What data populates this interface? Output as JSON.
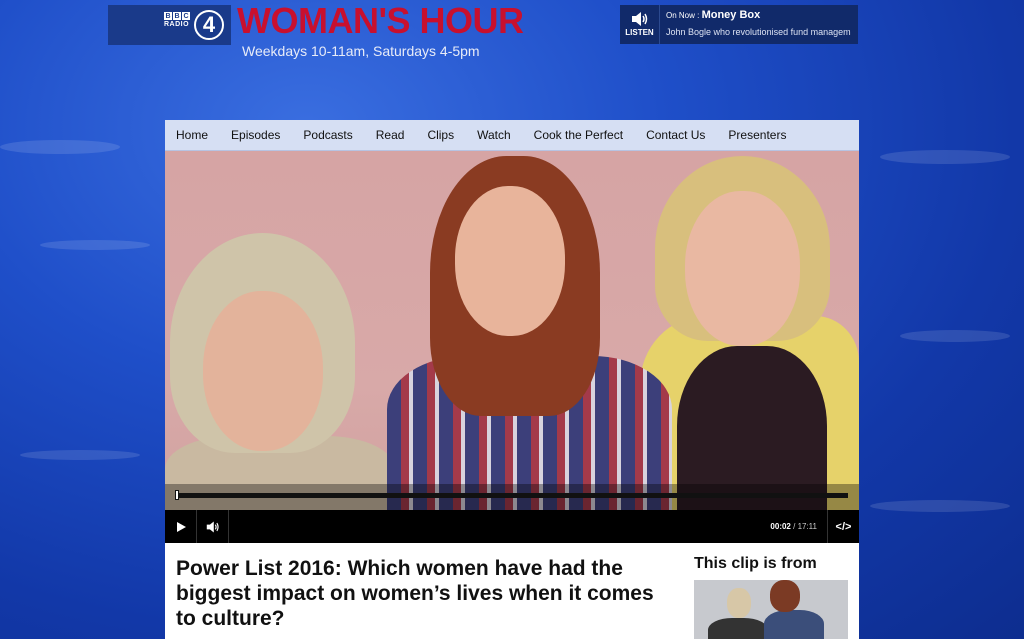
{
  "brand": {
    "bbc_letters": [
      "B",
      "B",
      "C"
    ],
    "radio_word": "RADIO",
    "station_number": "4",
    "show_title": "WOMAN'S HOUR",
    "schedule": "Weekdays 10-11am, Saturdays 4-5pm"
  },
  "on_now": {
    "listen_label": "LISTEN",
    "prefix": "On Now : ",
    "programme": "Money Box",
    "description": "John Bogle who revolutionised fund managem"
  },
  "nav": {
    "items": [
      "Home",
      "Episodes",
      "Podcasts",
      "Read",
      "Clips",
      "Watch",
      "Cook the Perfect",
      "Contact Us",
      "Presenters"
    ]
  },
  "player": {
    "current_time": "00:02",
    "separator": " / ",
    "duration": "17:11",
    "progress_fraction": 0.002,
    "embed_label": "</>"
  },
  "content": {
    "clip_title": "Power List 2016: Which women have had the biggest impact on women’s lives when it comes to culture?",
    "sidebar_title": "This clip is from"
  },
  "colors": {
    "brand_red": "#c8102e",
    "nav_bg": "#d6dff3",
    "background_blue": "#1f4fc9"
  }
}
